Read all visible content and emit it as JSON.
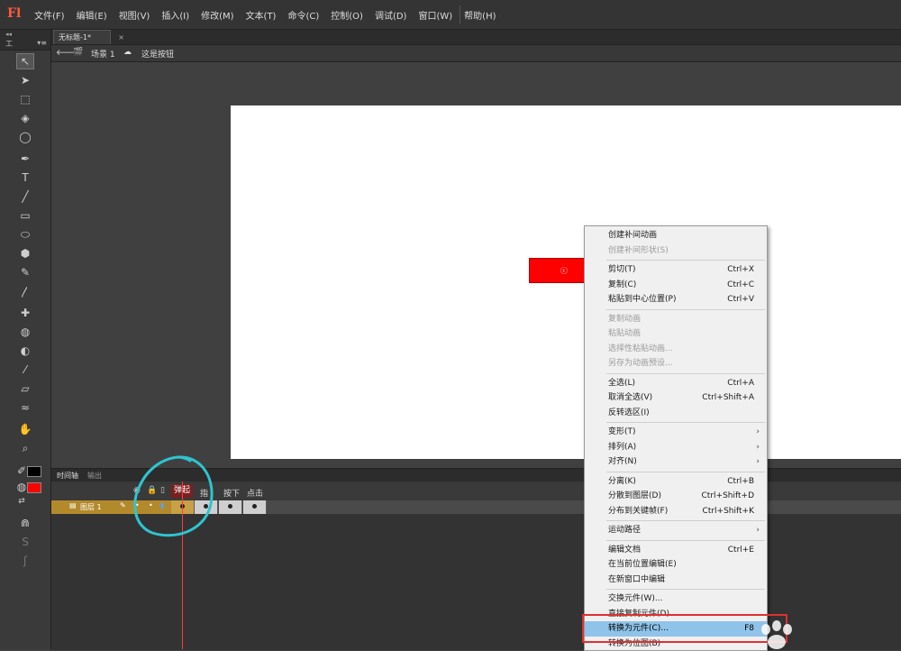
{
  "app": {
    "logo": "Fl"
  },
  "menubar": {
    "items": [
      "文件(F)",
      "编辑(E)",
      "视图(V)",
      "插入(I)",
      "修改(M)",
      "文本(T)",
      "命令(C)",
      "控制(O)",
      "调试(D)",
      "窗口(W)",
      "帮助(H)"
    ]
  },
  "tools_panel": {
    "collapse": "◂◂",
    "title": "工",
    "options": "▾≡",
    "stroke_color": "#000000",
    "fill_color": "#ff0000"
  },
  "document": {
    "tab_label": "无标题-1*",
    "tab_close": "×"
  },
  "edit_bar": {
    "scene_label": "场景 1",
    "symbol_label": "这是按钮"
  },
  "stage": {
    "button_color": "#ff0000",
    "button_mark": "ⓒ"
  },
  "timeline": {
    "tabs": [
      "时间轴",
      "输出"
    ],
    "frame_labels": [
      "弹起",
      "指",
      "按下",
      "点击"
    ],
    "layer_name": "图层 1",
    "layer_color": "#b38a2b"
  },
  "context_menu": {
    "items": [
      {
        "label": "创建补间动画",
        "shortcut": "",
        "disabled": false
      },
      {
        "label": "创建补间形状(S)",
        "shortcut": "",
        "disabled": true
      },
      {
        "sep": true
      },
      {
        "label": "剪切(T)",
        "shortcut": "Ctrl+X",
        "disabled": false
      },
      {
        "label": "复制(C)",
        "shortcut": "Ctrl+C",
        "disabled": false
      },
      {
        "label": "粘贴到中心位置(P)",
        "shortcut": "Ctrl+V",
        "disabled": false
      },
      {
        "sep": true
      },
      {
        "label": "复制动画",
        "shortcut": "",
        "disabled": true
      },
      {
        "label": "粘贴动画",
        "shortcut": "",
        "disabled": true
      },
      {
        "label": "选择性粘贴动画...",
        "shortcut": "",
        "disabled": true
      },
      {
        "label": "另存为动画预设...",
        "shortcut": "",
        "disabled": true
      },
      {
        "sep": true
      },
      {
        "label": "全选(L)",
        "shortcut": "Ctrl+A",
        "disabled": false
      },
      {
        "label": "取消全选(V)",
        "shortcut": "Ctrl+Shift+A",
        "disabled": false
      },
      {
        "label": "反转选区(I)",
        "shortcut": "",
        "disabled": false
      },
      {
        "sep": true
      },
      {
        "label": "变形(T)",
        "shortcut": "",
        "submenu": true,
        "disabled": false
      },
      {
        "label": "排列(A)",
        "shortcut": "",
        "submenu": true,
        "disabled": false
      },
      {
        "label": "对齐(N)",
        "shortcut": "",
        "submenu": true,
        "disabled": false
      },
      {
        "sep": true
      },
      {
        "label": "分离(K)",
        "shortcut": "Ctrl+B",
        "disabled": false
      },
      {
        "label": "分散到图层(D)",
        "shortcut": "Ctrl+Shift+D",
        "disabled": false
      },
      {
        "label": "分布到关键帧(F)",
        "shortcut": "Ctrl+Shift+K",
        "disabled": false
      },
      {
        "sep": true
      },
      {
        "label": "运动路径",
        "shortcut": "",
        "submenu": true,
        "disabled": false
      },
      {
        "sep": true
      },
      {
        "label": "编辑文档",
        "shortcut": "Ctrl+E",
        "disabled": false
      },
      {
        "label": "在当前位置编辑(E)",
        "shortcut": "",
        "disabled": false
      },
      {
        "label": "在新窗口中编辑",
        "shortcut": "",
        "disabled": false
      },
      {
        "sep": true
      },
      {
        "label": "交换元件(W)...",
        "shortcut": "",
        "disabled": false
      },
      {
        "label": "直接复制元件(D)...",
        "shortcut": "",
        "disabled": false
      },
      {
        "label": "转换为元件(C)...",
        "shortcut": "F8",
        "disabled": false,
        "highlighted": true
      },
      {
        "label": "转换为位图(B)",
        "shortcut": "",
        "disabled": false
      }
    ]
  }
}
